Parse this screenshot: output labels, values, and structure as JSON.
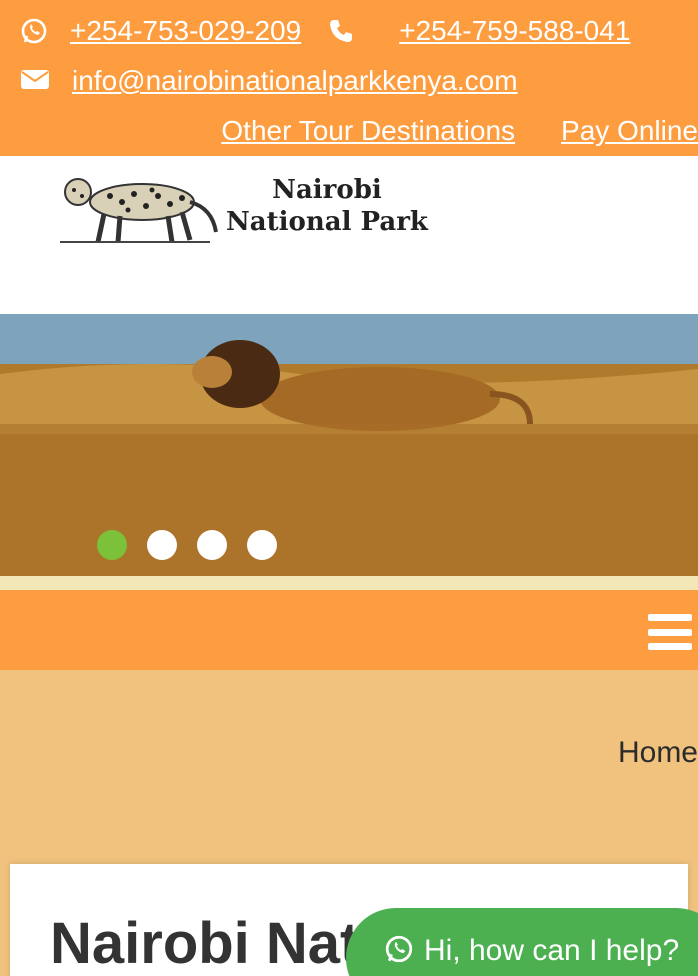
{
  "topbar": {
    "phone1": "+254-753-029-209",
    "phone2": "+254-759-588-041",
    "email": "info@nairobinationalparkkenya.com",
    "link_other_tours": "Other Tour Destinations",
    "link_pay_online": "Pay Online",
    "icons": [
      "whatsapp-icon",
      "phone-icon",
      "envelope-icon"
    ]
  },
  "logo": {
    "line1": "Nairobi",
    "line2": "National Park",
    "icon": "leopard-icon"
  },
  "slider": {
    "dots": [
      "slide-1",
      "slide-2",
      "slide-3",
      "slide-4"
    ],
    "active_index": 0
  },
  "nav": {
    "menu_icon": "hamburger-icon"
  },
  "breadcrumb": {
    "home": "Home"
  },
  "content": {
    "title": "Nairobi Nati"
  },
  "chat": {
    "label": "Hi, how can I help?",
    "icon": "whatsapp-icon"
  },
  "colors": {
    "orange": "#fe9d40",
    "tan_background": "#f0c27e",
    "green_dot": "#7cc13a",
    "whatsapp_green": "#4caf50"
  }
}
